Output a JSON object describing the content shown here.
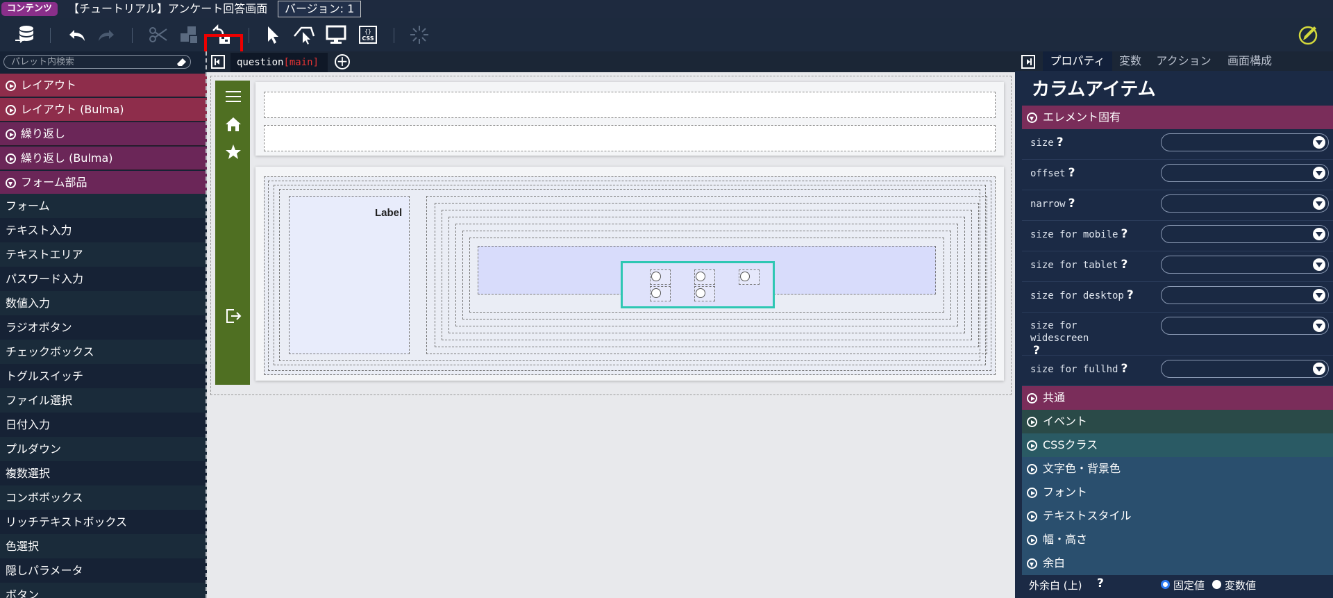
{
  "titlebar": {
    "badge": "コンテンツ",
    "title": "【チュートリアル】アンケート回答画面",
    "version": "バージョン: 1"
  },
  "toolbar": {
    "buttons": [
      "database-icon",
      "undo-icon",
      "redo-icon",
      "cut-icon",
      "copy-icon",
      "paste-icon",
      "select-icon",
      "select-parent-icon",
      "preview-icon",
      "css-icon",
      "loading-icon",
      "edit-icon"
    ],
    "css_label": "CSS",
    "highlight_color": "#ee0000"
  },
  "palette": {
    "search_placeholder": "パレット内検索",
    "categories": [
      {
        "label": "レイアウト",
        "color": "#8e2d4b"
      },
      {
        "label": "レイアウト (Bulma)",
        "color": "#8e2d4b"
      },
      {
        "label": "繰り返し",
        "color": "#6b2658"
      },
      {
        "label": "繰り返し (Bulma)",
        "color": "#6b2658"
      },
      {
        "label": "フォーム部品",
        "color": "#6b2658"
      }
    ],
    "items": [
      "フォーム",
      "テキスト入力",
      "テキストエリア",
      "パスワード入力",
      "数値入力",
      "ラジオボタン",
      "チェックボックス",
      "トグルスイッチ",
      "ファイル選択",
      "日付入力",
      "プルダウン",
      "複数選択",
      "コンボボックス",
      "リッチテキストボックス",
      "色選択",
      "隠しパラメータ",
      "ボタン"
    ]
  },
  "editor": {
    "tab_name": "question",
    "tab_sub": "[main]",
    "label_text": "Label",
    "sidenav_color": "#4f6f22",
    "selected_color": "#2ec7b3"
  },
  "properties": {
    "tabs": [
      "プロパティ",
      "変数",
      "アクション",
      "画面構成"
    ],
    "active_tab": "プロパティ",
    "heading": "カラムアイテム",
    "element_section": "エレメント固有",
    "rows": [
      {
        "label": "size"
      },
      {
        "label": "offset"
      },
      {
        "label": "narrow"
      },
      {
        "label": "size for mobile"
      },
      {
        "label": "size for tablet"
      },
      {
        "label": "size for desktop"
      },
      {
        "label": "size for widescreen"
      },
      {
        "label": "size for fullhd"
      }
    ],
    "sections": [
      {
        "label": "共通",
        "color": "#7a2d5a"
      },
      {
        "label": "イベント",
        "color": "#2a4a48"
      },
      {
        "label": "CSSクラス",
        "color": "#2a5a64"
      },
      {
        "label": "文字色・背景色",
        "color": "#2a4f6e"
      },
      {
        "label": "フォント",
        "color": "#2a4f6e"
      },
      {
        "label": "テキストスタイル",
        "color": "#2a4f6e"
      },
      {
        "label": "幅・高さ",
        "color": "#2a4f6e"
      },
      {
        "label": "余白",
        "color": "#2a4f6e"
      }
    ],
    "margin_top_label": "外余白 (上)",
    "radio_fixed": "固定値",
    "radio_variable": "変数値"
  }
}
